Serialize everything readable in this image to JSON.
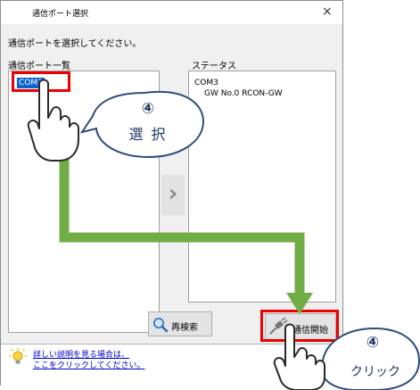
{
  "window": {
    "title": "通信ポート選択",
    "close_glyph": "×"
  },
  "prompt": "通信ポートを選択してください。",
  "port_list": {
    "header": "通信ポート一覧",
    "items": [
      "COM3"
    ]
  },
  "status": {
    "header": "ステータス",
    "lines": [
      "COM3",
      "GW  No.0 RCON-GW"
    ]
  },
  "arrow_glyph": "›",
  "buttons": {
    "research": "再検索",
    "start": "通信開始"
  },
  "hint": {
    "line1": "詳しい説明を見る場合は、",
    "line2": "ここをクリックしてください。"
  },
  "callouts": {
    "select": {
      "number": "④",
      "label": "選 択"
    },
    "click": {
      "number": "④",
      "label": "クリック"
    }
  },
  "colors": {
    "highlight": "#ee0000",
    "arrow": "#70ad47",
    "bubble_border": "#2e4b7a",
    "selection": "#0a64d2"
  }
}
